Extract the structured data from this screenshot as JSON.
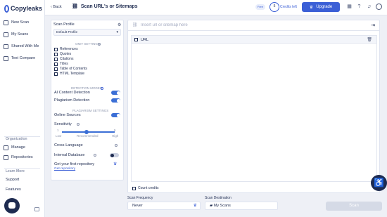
{
  "nav": {
    "logo_text": "Copyleaks",
    "items": [
      {
        "label": "New Scan"
      },
      {
        "label": "My Scans"
      },
      {
        "label": "Shared With Me"
      },
      {
        "label": "Text Compare"
      }
    ],
    "org_section": "Organization",
    "org_items": [
      {
        "label": "Manage"
      },
      {
        "label": "Repositories"
      }
    ],
    "learn_section": "Learn More",
    "learn_items": [
      {
        "label": "Support"
      },
      {
        "label": "Features"
      }
    ]
  },
  "topbar": {
    "back_label": "Back",
    "title": "Scan URL's or Sitemaps",
    "plan_badge": "Free",
    "credits_count": "5",
    "credits_label": "Credits left",
    "upgrade_label": "Upgrade"
  },
  "panel": {
    "profile_label": "Scan Profile",
    "profile_value": "Default Profile",
    "omit_heading": "OMIT SETTINGS",
    "omit_items": [
      {
        "label": "References"
      },
      {
        "label": "Quotes"
      },
      {
        "label": "Citations"
      },
      {
        "label": "Titles"
      },
      {
        "label": "Table of Contents"
      },
      {
        "label": "HTML Template"
      }
    ],
    "detection_heading": "DETECTION MODES",
    "ai_detection": "AI Content Detection",
    "plagiarism_detection": "Plagiarism Detection",
    "plag_heading": "PLAGIARISM SETTINGS",
    "online_sources": "Online Sources",
    "sensitivity_label": "Sensitivity",
    "sensitivity_min": "1",
    "sensitivity_max": "5",
    "sensitivity_low": "Low",
    "sensitivity_mid": "Recommended",
    "sensitivity_high": "High",
    "cross_language": "Cross-Language",
    "internal_db": "Internal Database",
    "repo_prompt": "Get your first repository",
    "repo_link": "Get repository",
    "ai_on": true,
    "plag_on": true,
    "online_on": true,
    "internal_on": false
  },
  "main": {
    "url_placeholder": "Insert url or sitemap here",
    "column_url": "URL",
    "count_credits": "Count credits"
  },
  "bottom": {
    "frequency_label": "Scan Frequency",
    "frequency_value": "Never",
    "destination_label": "Scan Destination",
    "destination_value": "My Scans",
    "scan_button": "Scan"
  },
  "colors": {
    "accent": "#3b5fd6",
    "navy": "#1e2b50"
  }
}
